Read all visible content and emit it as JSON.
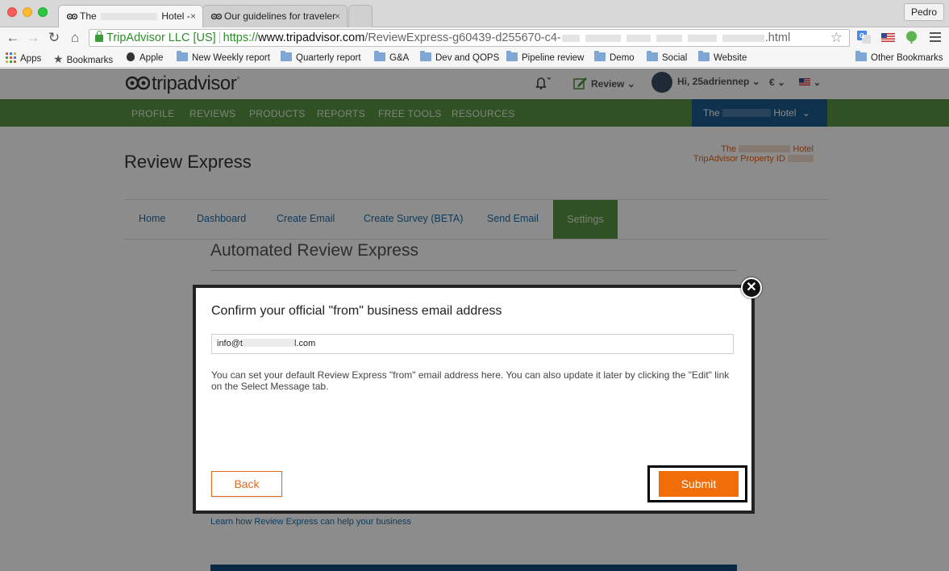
{
  "browser": {
    "tabs": [
      {
        "title_prefix": "The",
        "title_suffix": "Hotel -",
        "close": "×",
        "active": true
      },
      {
        "title": "Our guidelines for traveler",
        "close": "×",
        "active": false
      }
    ],
    "profile": "Pedro",
    "nav": {
      "back": "←",
      "forward": "→",
      "reload": "↻",
      "home": "⌂"
    },
    "address": {
      "org": "TripAdvisor LLC [US]",
      "scheme": "https://",
      "host": "www.tripadvisor.com",
      "path": "/ReviewExpress-g60439-d255670-c4-",
      "path_end": ".html"
    },
    "bookmarks": [
      {
        "label": "Apps",
        "icon": "apps-grid-icon"
      },
      {
        "label": "Bookmarks",
        "icon": "star-icon"
      },
      {
        "label": "Apple",
        "icon": "apple-icon"
      },
      {
        "label": "New Weekly report",
        "icon": "folder-icon"
      },
      {
        "label": "Quarterly report",
        "icon": "folder-icon"
      },
      {
        "label": "G&A",
        "icon": "folder-icon"
      },
      {
        "label": "Dev and QOPS",
        "icon": "folder-icon"
      },
      {
        "label": "Pipeline review",
        "icon": "folder-icon"
      },
      {
        "label": "Demo",
        "icon": "folder-icon"
      },
      {
        "label": "Social",
        "icon": "folder-icon"
      },
      {
        "label": "Website",
        "icon": "folder-icon"
      }
    ],
    "other_bookmarks": "Other Bookmarks"
  },
  "site": {
    "logo": "tripadvisor",
    "logo_mark": "°",
    "header": {
      "bell": "🔔",
      "review": "Review",
      "greeting": "Hi, 25adriennep",
      "currency": "€"
    },
    "main_nav": [
      "PROFILE",
      "REVIEWS",
      "PRODUCTS",
      "REPORTS",
      "FREE TOOLS",
      "RESOURCES"
    ],
    "hotel_dropdown": {
      "prefix": "The",
      "suffix": "Hotel"
    },
    "property": {
      "line1_prefix": "The",
      "line1_suffix": "Hotel",
      "line2": "TripAdvisor Property ID"
    },
    "page_title": "Review Express",
    "subnav": [
      "Home",
      "Dashboard",
      "Create Email",
      "Create Survey (BETA)",
      "Send Email",
      "Settings"
    ],
    "active_subnav": "Settings",
    "section_title": "Automated Review Express",
    "learn_link": "Learn how Review Express can help your business"
  },
  "modal": {
    "title": "Confirm your official \"from\" business email address",
    "email_prefix": "info@t",
    "email_suffix": "l.com",
    "description": "You can set your default Review Express \"from\" email address here. You can also update it later by clicking the \"Edit\" link on the Select Message tab.",
    "back_label": "Back",
    "submit_label": "Submit",
    "close_symbol": "✕"
  },
  "colors": {
    "nav_green": "#589442",
    "dropdown_blue": "#1b5a8c",
    "accent_orange": "#f06d0a",
    "link_blue": "#1a6ea8"
  }
}
